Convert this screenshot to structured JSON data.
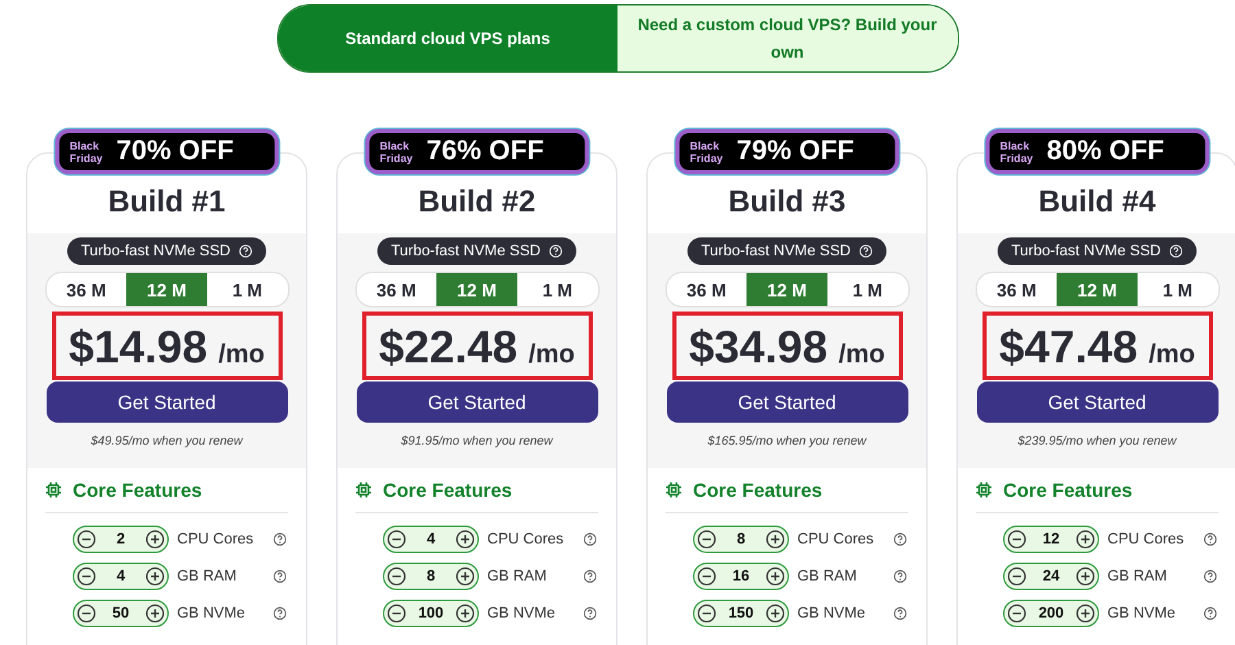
{
  "plan_tabs": [
    {
      "label": "Standard cloud VPS plans",
      "selected": true
    },
    {
      "label": "Need a custom cloud VPS? Build your own",
      "selected": false
    }
  ],
  "plans": [
    {
      "badge_small": "Black Friday",
      "badge": "70% OFF",
      "title": "Build #1",
      "storage_pill": "Turbo-fast NVMe SSD",
      "periods": [
        {
          "label": "36 M",
          "selected": false
        },
        {
          "label": "12 M",
          "selected": true
        },
        {
          "label": "1 M",
          "selected": false
        }
      ],
      "price": "$14.98",
      "price_unit": "/mo",
      "button": "Get Started",
      "renew": "$49.95/mo when you renew",
      "features_title": "Core Features",
      "features": [
        {
          "value": "2",
          "label": "CPU Cores"
        },
        {
          "value": "4",
          "label": "GB RAM"
        },
        {
          "value": "50",
          "label": "GB NVMe"
        }
      ]
    },
    {
      "badge_small": "Black Friday",
      "badge": "76% OFF",
      "title": "Build #2",
      "storage_pill": "Turbo-fast NVMe SSD",
      "periods": [
        {
          "label": "36 M",
          "selected": false
        },
        {
          "label": "12 M",
          "selected": true
        },
        {
          "label": "1 M",
          "selected": false
        }
      ],
      "price": "$22.48",
      "price_unit": "/mo",
      "button": "Get Started",
      "renew": "$91.95/mo when you renew",
      "features_title": "Core Features",
      "features": [
        {
          "value": "4",
          "label": "CPU Cores"
        },
        {
          "value": "8",
          "label": "GB RAM"
        },
        {
          "value": "100",
          "label": "GB NVMe"
        }
      ]
    },
    {
      "badge_small": "Black Friday",
      "badge": "79% OFF",
      "title": "Build #3",
      "storage_pill": "Turbo-fast NVMe SSD",
      "periods": [
        {
          "label": "36 M",
          "selected": false
        },
        {
          "label": "12 M",
          "selected": true
        },
        {
          "label": "1 M",
          "selected": false
        }
      ],
      "price": "$34.98",
      "price_unit": "/mo",
      "button": "Get Started",
      "renew": "$165.95/mo when you renew",
      "features_title": "Core Features",
      "features": [
        {
          "value": "8",
          "label": "CPU Cores"
        },
        {
          "value": "16",
          "label": "GB RAM"
        },
        {
          "value": "150",
          "label": "GB NVMe"
        }
      ]
    },
    {
      "badge_small": "Black Friday",
      "badge": "80% OFF",
      "title": "Build #4",
      "storage_pill": "Turbo-fast NVMe SSD",
      "periods": [
        {
          "label": "36 M",
          "selected": false
        },
        {
          "label": "12 M",
          "selected": true
        },
        {
          "label": "1 M",
          "selected": false
        }
      ],
      "price": "$47.48",
      "price_unit": "/mo",
      "button": "Get Started",
      "renew": "$239.95/mo when you renew",
      "features_title": "Core Features",
      "features": [
        {
          "value": "12",
          "label": "CPU Cores"
        },
        {
          "value": "24",
          "label": "GB RAM"
        },
        {
          "value": "200",
          "label": "GB NVMe"
        }
      ]
    }
  ]
}
